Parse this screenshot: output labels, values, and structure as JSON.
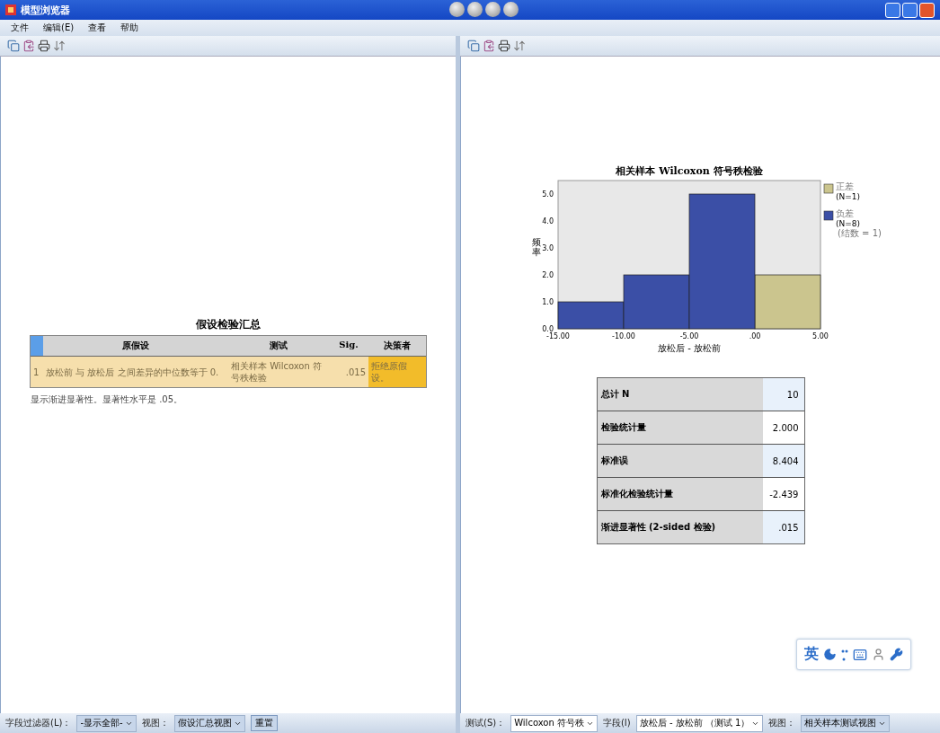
{
  "window": {
    "title": "模型浏览器"
  },
  "menu": [
    {
      "label": "文件"
    },
    {
      "label": "编辑(E)"
    },
    {
      "label": "查看"
    },
    {
      "label": "帮助"
    }
  ],
  "left_pane": {
    "summary": {
      "title": "假设检验汇总",
      "columns": [
        "原假设",
        "测试",
        "Sig.",
        "决策者"
      ],
      "rows": [
        {
          "index": "1",
          "hypothesis": "放松前 与 放松后 之间差异的中位数等于 0.",
          "test": "相关样本 Wilcoxon 符号秩检验",
          "sig": ".015",
          "decision": "拒绝原假设。",
          "selected": true
        }
      ],
      "footnote": "显示渐进显著性。显著性水平是 .05。"
    },
    "footer": {
      "filter_label": "字段过滤器(L)：",
      "filter_value": "-显示全部-",
      "view_label": "视图：",
      "view_value": "假设汇总视图",
      "reset": "重置"
    }
  },
  "right_pane": {
    "chart": {
      "chart_data": {
        "type": "bar",
        "title": "相关样本 Wilcoxon 符号秩检验",
        "xlabel": "放松后 - 放松前",
        "ylabel": "频率",
        "x": [
          -12.5,
          -7.5,
          -2.5,
          2.5
        ],
        "series": [
          {
            "name": "正差",
            "color": "#cbc58e",
            "values": [
              null,
              null,
              null,
              2
            ]
          },
          {
            "name": "负差",
            "color": "#3b4fa6",
            "values": [
              1,
              2,
              5,
              null
            ]
          }
        ],
        "legend": [
          {
            "count": "(N=1)"
          },
          {
            "count": "(N=8)",
            "note": "(结数 = 1)"
          }
        ],
        "xlim": [
          -15,
          5
        ],
        "ylim": [
          0,
          5.5
        ],
        "xticks": [
          {
            "value": -15,
            "label": "-15.00"
          },
          {
            "value": -10,
            "label": "-10.00"
          },
          {
            "value": -5,
            "label": "-5.00"
          },
          {
            "value": 0,
            "label": ".00"
          },
          {
            "value": 5,
            "label": "5.00"
          }
        ],
        "yticks": [
          {
            "value": 0,
            "label": "0.0"
          },
          {
            "value": 1,
            "label": "1.0"
          },
          {
            "value": 2,
            "label": "2.0"
          },
          {
            "value": 3,
            "label": "3.0"
          },
          {
            "value": 4,
            "label": "4.0"
          },
          {
            "value": 5,
            "label": "5.0"
          }
        ]
      }
    },
    "stats": [
      {
        "label": "总计 N",
        "value": "10"
      },
      {
        "label": "检验统计量",
        "value": "2.000"
      },
      {
        "label": "标准误",
        "value": "8.404"
      },
      {
        "label": "标准化检验统计量",
        "value": "-2.439"
      },
      {
        "label": "渐进显著性 (2-sided 检验)",
        "value": ".015"
      }
    ],
    "footer": {
      "test_label": "测试(S)：",
      "test_value": "Wilcoxon 符号秩",
      "field_label": "字段(I)",
      "field_value": "放松后 - 放松前 （测试 1）",
      "view_label": "视图：",
      "view_value": "相关样本测试视图"
    }
  },
  "ime": {
    "mode": "英"
  }
}
